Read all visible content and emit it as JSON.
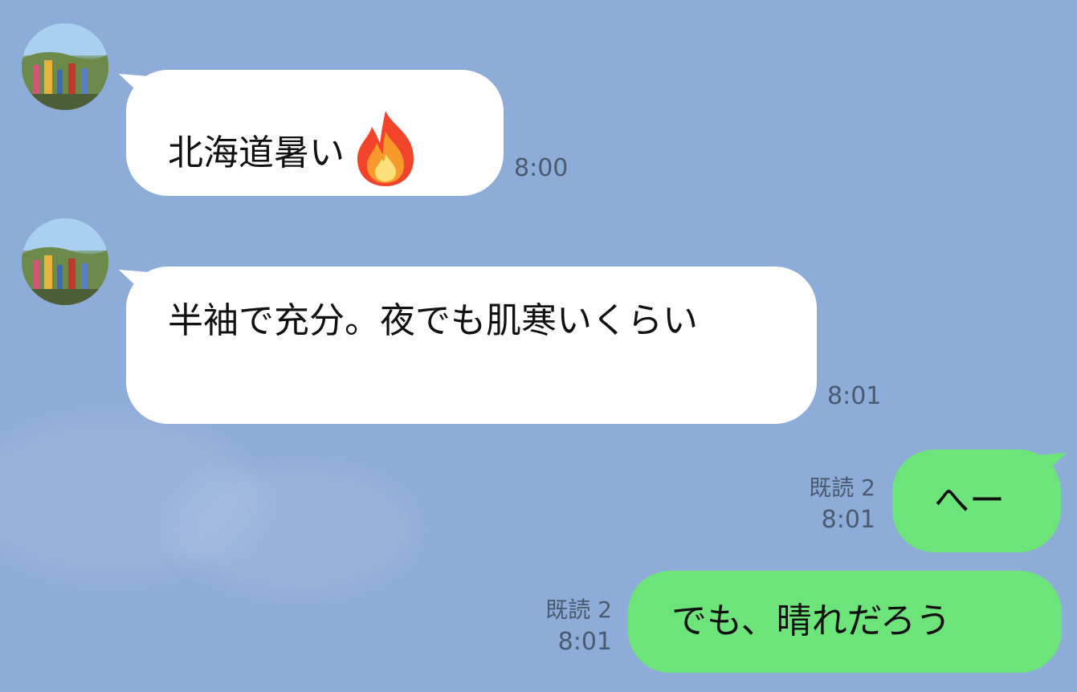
{
  "chat": {
    "messages": [
      {
        "direction": "in",
        "text": "北海道暑い",
        "emoji_icon": "fire-icon",
        "time": "8:00"
      },
      {
        "direction": "in",
        "text": "半袖で充分。夜でも肌寒いくらい",
        "time": "8:01"
      },
      {
        "direction": "out",
        "text": "へー",
        "read": "既読 2",
        "time": "8:01"
      },
      {
        "direction": "out",
        "text": "でも、晴れだろう",
        "read": "既読 2",
        "time": "8:01"
      }
    ]
  },
  "colors": {
    "background": "#8eacd8",
    "incoming_bubble": "#ffffff",
    "outgoing_bubble": "#6de47a",
    "meta_text": "#4a5a70"
  }
}
